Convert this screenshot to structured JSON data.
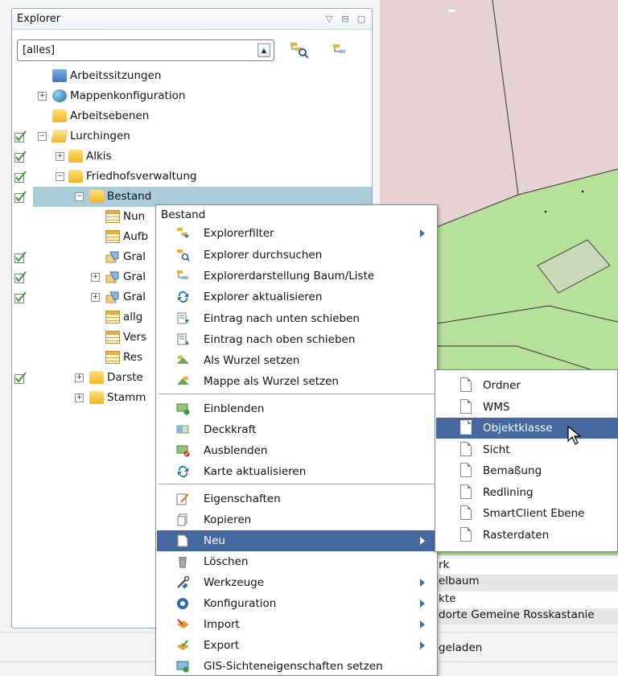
{
  "explorer": {
    "title": "Explorer",
    "filter_value": "[alles]",
    "tree": [
      {
        "label": "Arbeitssitzungen",
        "icon": "sessions-icon",
        "checked": false,
        "expander": ""
      },
      {
        "label": "Mappenkonfiguration",
        "icon": "globe-icon",
        "checked": false,
        "expander": "+"
      },
      {
        "label": "Arbeitsebenen",
        "icon": "folder-icon",
        "checked": false,
        "expander": ""
      },
      {
        "label": "Lurchingen",
        "icon": "folder-open-icon",
        "checked": true,
        "expander": "−"
      },
      {
        "label": "Alkis",
        "icon": "folder-icon",
        "checked": true,
        "expander": "+"
      },
      {
        "label": "Friedhofsverwaltung",
        "icon": "folder-icon",
        "checked": true,
        "expander": "−"
      },
      {
        "label": "Bestand",
        "icon": "folder-icon",
        "checked": true,
        "expander": "−"
      },
      {
        "label": "Nun",
        "icon": "table-icon",
        "checked": false,
        "expander": ""
      },
      {
        "label": "Aufb",
        "icon": "table-icon",
        "checked": false,
        "expander": ""
      },
      {
        "label": "Gral",
        "icon": "layer-icon",
        "checked": true,
        "expander": ""
      },
      {
        "label": "Gral",
        "icon": "layer-icon",
        "checked": true,
        "expander": "+"
      },
      {
        "label": "Gral",
        "icon": "layer-icon",
        "checked": true,
        "expander": "+"
      },
      {
        "label": "allg",
        "icon": "table-icon",
        "checked": false,
        "expander": ""
      },
      {
        "label": "Vers",
        "icon": "table-icon",
        "checked": false,
        "expander": ""
      },
      {
        "label": "Res",
        "icon": "table-icon",
        "checked": false,
        "expander": ""
      },
      {
        "label": "Darste",
        "icon": "folder-icon",
        "checked": true,
        "expander": "+"
      },
      {
        "label": "Stamm",
        "icon": "folder-icon",
        "checked": false,
        "expander": "+"
      }
    ]
  },
  "context_menu": {
    "title": "Bestand",
    "items": [
      {
        "label": "Explorerfilter",
        "icon": "filter-icon",
        "submenu": true
      },
      {
        "label": "Explorer durchsuchen",
        "icon": "search-tree-icon",
        "submenu": false
      },
      {
        "label": "Explorerdarstellung Baum/Liste",
        "icon": "tree-list-icon",
        "submenu": false
      },
      {
        "label": "Explorer aktualisieren",
        "icon": "refresh-icon",
        "submenu": false
      },
      {
        "label": "Eintrag nach unten schieben",
        "icon": "move-down-icon",
        "submenu": false
      },
      {
        "label": "Eintrag nach oben schieben",
        "icon": "move-up-icon",
        "submenu": false
      },
      {
        "label": "Als Wurzel setzen",
        "icon": "root-icon",
        "submenu": false
      },
      {
        "label": "Mappe als Wurzel setzen",
        "icon": "map-root-icon",
        "submenu": false
      },
      {
        "label": "Einblenden",
        "icon": "show-layer-icon",
        "submenu": false
      },
      {
        "label": "Deckkraft",
        "icon": "opacity-icon",
        "submenu": false
      },
      {
        "label": "Ausblenden",
        "icon": "hide-layer-icon",
        "submenu": false
      },
      {
        "label": "Karte aktualisieren",
        "icon": "refresh-map-icon",
        "submenu": false
      },
      {
        "label": "Eigenschaften",
        "icon": "properties-icon",
        "submenu": false
      },
      {
        "label": "Kopieren",
        "icon": "copy-icon",
        "submenu": false
      },
      {
        "label": "Neu",
        "icon": "new-document-icon",
        "submenu": true
      },
      {
        "label": "Löschen",
        "icon": "trash-icon",
        "submenu": false
      },
      {
        "label": "Werkzeuge",
        "icon": "tools-icon",
        "submenu": true
      },
      {
        "label": "Konfiguration",
        "icon": "config-icon",
        "submenu": true
      },
      {
        "label": "Import",
        "icon": "import-icon",
        "submenu": true
      },
      {
        "label": "Export",
        "icon": "export-icon",
        "submenu": true
      },
      {
        "label": "GIS-Sichteneigenschaften setzen",
        "icon": "gis-view-icon",
        "submenu": false
      }
    ]
  },
  "new_submenu": {
    "items": [
      "Ordner",
      "WMS",
      "Objektklasse",
      "Sicht",
      "Bemaßung",
      "Redlining",
      "SmartClient Ebene",
      "Rasterdaten"
    ],
    "highlighted": "Objektklasse"
  },
  "background_list": {
    "rows": [
      "rk",
      "elbaum",
      "kte",
      "dorte Gemeine Rosskastanie"
    ]
  },
  "status": {
    "text": "geladen"
  },
  "colors": {
    "highlight": "#45689e",
    "selected_row": "#a9ccd8",
    "map_green": "#b7e09a",
    "map_pink": "#e8d3d3"
  }
}
